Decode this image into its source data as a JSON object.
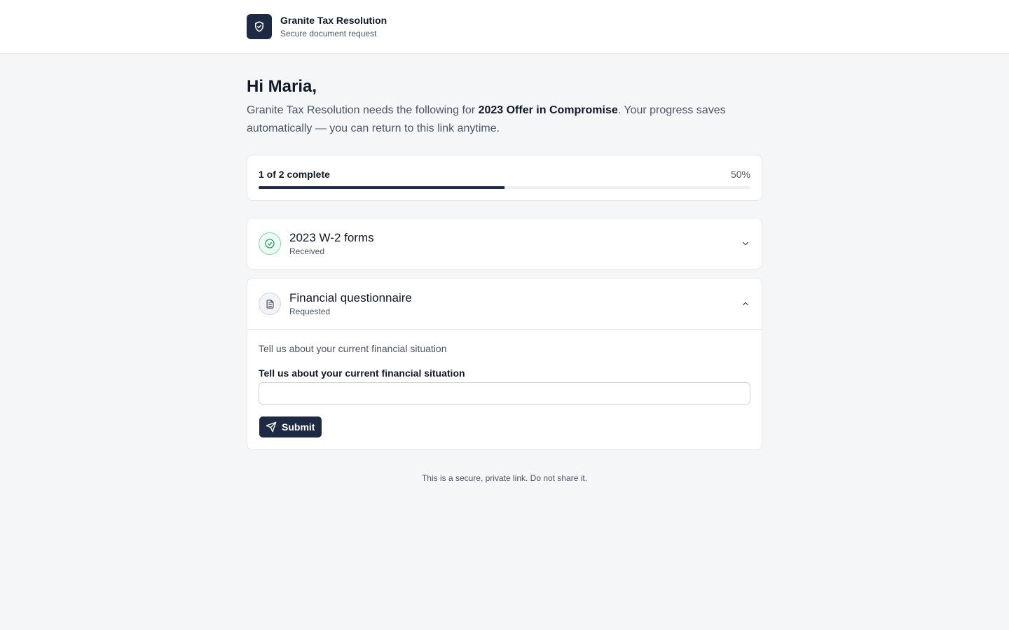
{
  "header": {
    "brand_name": "Granite Tax Resolution",
    "brand_subtitle": "Secure document request",
    "logo_icon": "shield-check-icon"
  },
  "intro": {
    "greeting": "Hi Maria,",
    "text_before": "Granite Tax Resolution needs the following for ",
    "request_name": "2023 Offer in Compromise",
    "text_after": ". Your progress saves automatically — you can return to this link anytime."
  },
  "progress": {
    "label": "1 of 2 complete",
    "percent_label": "50%",
    "fraction": 0.5
  },
  "items": [
    {
      "title": "2023 W-2 forms",
      "status": "Received",
      "icon": "check-circle-icon",
      "expanded": false
    },
    {
      "title": "Financial questionnaire",
      "status": "Requested",
      "icon": "document-icon",
      "expanded": true,
      "description": "Tell us about your current financial situation",
      "field_label": "Tell us about your current financial situation",
      "field_value": "",
      "submit_label": "Submit"
    }
  ],
  "footer": {
    "note": "This is a secure, private link. Do not share it."
  },
  "colors": {
    "accent": "#1e2a44",
    "success": "#2f9e5b"
  }
}
